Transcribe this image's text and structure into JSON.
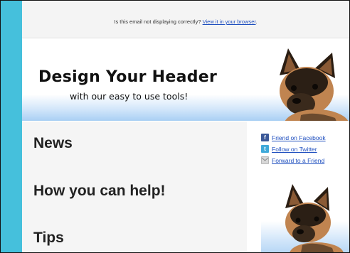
{
  "preheader": {
    "text": "Is this email not displaying correctly?",
    "link": "View it in your browser",
    "suffix": "."
  },
  "header": {
    "title": "Design Your Header",
    "subtitle": "with our easy to use tools!"
  },
  "content": {
    "headings": [
      "News",
      "How you can help!",
      "Tips"
    ]
  },
  "sidebar": {
    "social_links": [
      {
        "label": "Friend on Facebook",
        "icon": "facebook-icon"
      },
      {
        "label": "Follow on Twitter",
        "icon": "twitter-icon"
      },
      {
        "label": "Forward to a Friend",
        "icon": "mail-icon"
      }
    ]
  },
  "colors": {
    "accent_bar": "#45c0dc",
    "link": "#1f4fbf",
    "header_gradient_end": "#a9cff4"
  }
}
